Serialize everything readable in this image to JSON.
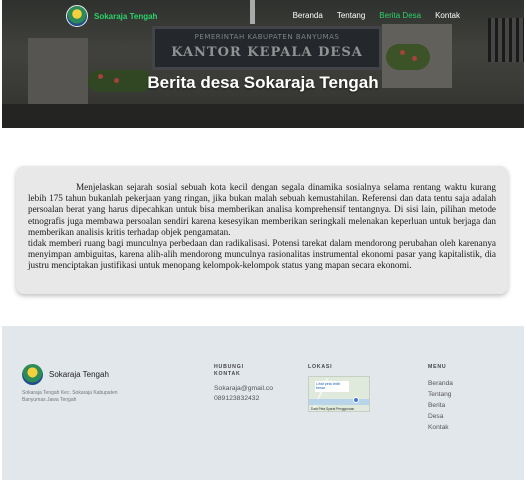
{
  "brand": {
    "name": "Sokaraja Tengah"
  },
  "nav": {
    "items": [
      {
        "label": "Beranda",
        "active": false
      },
      {
        "label": "Tentang",
        "active": false
      },
      {
        "label": "Berita Desa",
        "active": true
      },
      {
        "label": "Kontak",
        "active": false
      }
    ]
  },
  "hero": {
    "title": "Berita desa Sokaraja Tengah",
    "sign_line1": "PEMERINTAH KABUPATEN BANYUMAS",
    "sign_line2": "KANTOR KEPALA DESA"
  },
  "article": {
    "paragraph1": "Menjelaskan sejarah sosial sebuah kota kecil dengan segala dinamika sosialnya selama rentang waktu kurang lebih 175 tahun bukanlah pekerjaan yang ringan, jika bukan malah sebuah kemustahilan. Referensi dan data tentu saja adalah persoalan berat yang harus dipecahkan untuk bisa memberikan analisa komprehensif tentangnya. Di sisi lain, pilihan metode etnografis juga membawa persoalan sendiri karena kesesyikan memberikan seringkali melenakan keperluan untuk berjaga dan memberikan analisis kritis terhadap objek pengamatan.",
    "paragraph2": "tidak memberi ruang bagi munculnya perbedaan dan radikalisasi. Potensi tarekat dalam mendorong perubahan oleh karenanya menyimpan ambiguitas, karena alih-alih mendorong munculnya rasionalitas instrumental ekonomi pasar yang kapitalistik, dia justru menciptakan justifikasi untuk menopang kelompok-kelompok status yang mapan secara ekonomi."
  },
  "footer": {
    "brand_name": "Sokaraja Tengah",
    "address": "Sokaraja Tengah Kec. Sokaraja Kabupaten Banyumas Jawa Tengah",
    "contact_heading": "HUBUNGI KONTAK",
    "email": "Sokaraja@gmail.co",
    "phone": "089123832432",
    "location_heading": "LOKASI",
    "map_label": "Lihat peta lebih besar",
    "map_attrib": "Data Peta   Syarat Penggunaan",
    "menu_heading": "MENU",
    "menu_items": [
      "Beranda",
      "Tentang",
      "Berita",
      "Desa",
      "Kontak"
    ]
  }
}
